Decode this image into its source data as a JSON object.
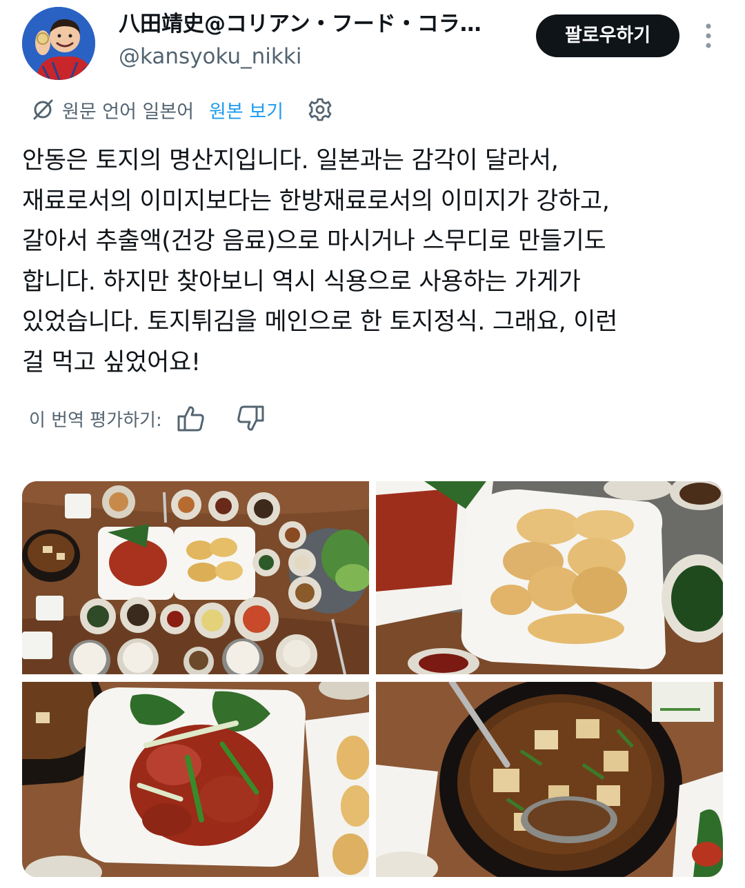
{
  "header": {
    "display_name": "八田靖史@コリアン・フード・コラ…",
    "handle": "@kansyoku_nikki",
    "follow_label": "팔로우하기"
  },
  "translation": {
    "source_language": "원문 언어 일본어",
    "show_original_label": "원본 보기"
  },
  "post": {
    "lines": [
      "안동은 토지의 명산지입니다. 일본과는 감각이 달라서,",
      "재료로서의 이미지보다는 한방재료로서의 이미지가 강하고,",
      "갈아서 추출액(건강 음료)으로 마시거나 스무디로 만들기도",
      "합니다. 하지만 찾아보니 역시 식용으로 사용하는 가게가",
      "있었습니다. 토지튀김을 메인으로 한 토지정식. 그래요, 이런",
      "걸 먹고 싶었어요!"
    ]
  },
  "rating": {
    "label": "이 번역 평가하기:"
  },
  "photos": [
    {
      "subject": "table-set-meal"
    },
    {
      "subject": "fried-toji-plate"
    },
    {
      "subject": "spicy-pork-plate"
    },
    {
      "subject": "stew-pot"
    }
  ],
  "colors": {
    "follow_bg": "#0f1419",
    "link": "#1d9bf0",
    "secondary_text": "#536471"
  },
  "icons": {
    "translate": "translate-slash-icon",
    "settings": "gear-icon",
    "more": "more-vertical-icon",
    "like": "thumbs-up-icon",
    "dislike": "thumbs-down-icon"
  }
}
